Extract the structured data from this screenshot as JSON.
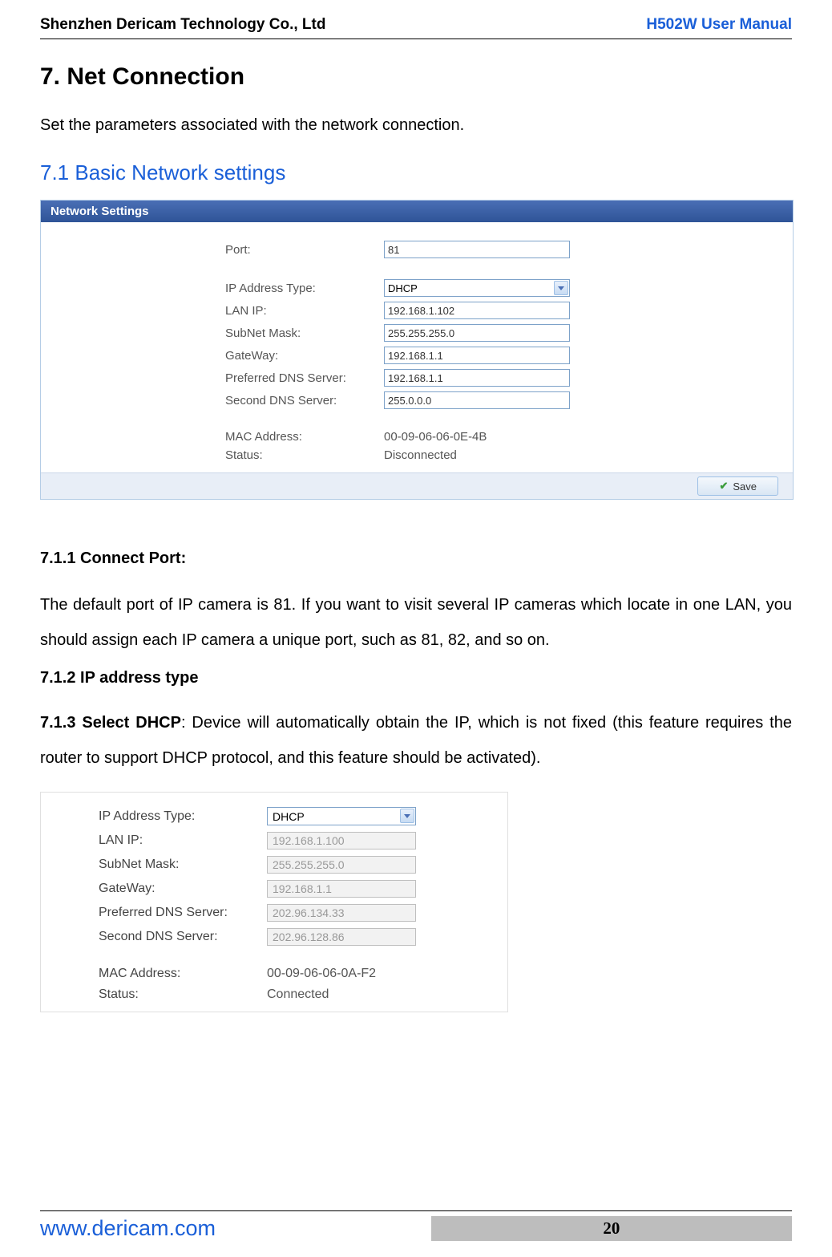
{
  "header": {
    "company": "Shenzhen Dericam Technology Co., Ltd",
    "manual": "H502W User Manual"
  },
  "h1": "7. Net Connection",
  "intro": "Set the parameters associated with the network connection.",
  "h2": "7.1 Basic Network settings",
  "panel1": {
    "title": "Network Settings",
    "port_label": "Port:",
    "port": "81",
    "iptype_label": "IP Address Type:",
    "iptype": "DHCP",
    "lanip_label": "LAN IP:",
    "lanip": "192.168.1.102",
    "subnet_label": "SubNet Mask:",
    "subnet": "255.255.255.0",
    "gw_label": "GateWay:",
    "gw": "192.168.1.1",
    "dns1_label": "Preferred DNS Server:",
    "dns1": "192.168.1.1",
    "dns2_label": "Second DNS Server:",
    "dns2": "255.0.0.0",
    "mac_label": "MAC Address:",
    "mac": "00-09-06-06-0E-4B",
    "status_label": "Status:",
    "status": "Disconnected",
    "save": "Save"
  },
  "h3_711": "7.1.1 Connect Port:",
  "para711": "The default port of IP camera is 81. If you want to visit several IP cameras which locate in one LAN, you should assign each IP camera a unique port, such as 81, 82, and so on.",
  "h3_712": "7.1.2 IP address type",
  "h3_713_bold": "7.1.3 Select DHCP",
  "h3_713_rest": ": Device will automatically obtain the IP, which is not fixed (this feature requires the router to support DHCP protocol, and this feature should be activated).",
  "panel2": {
    "iptype_label": "IP Address Type:",
    "iptype": "DHCP",
    "lanip_label": "LAN IP:",
    "lanip": "192.168.1.100",
    "subnet_label": "SubNet Mask:",
    "subnet": "255.255.255.0",
    "gw_label": "GateWay:",
    "gw": "192.168.1.1",
    "dns1_label": "Preferred DNS Server:",
    "dns1": "202.96.134.33",
    "dns2_label": "Second DNS Server:",
    "dns2": "202.96.128.86",
    "mac_label": "MAC Address:",
    "mac": "00-09-06-06-0A-F2",
    "status_label": "Status:",
    "status": "Connected"
  },
  "footer": {
    "url": "www.dericam.com",
    "page": "20"
  }
}
